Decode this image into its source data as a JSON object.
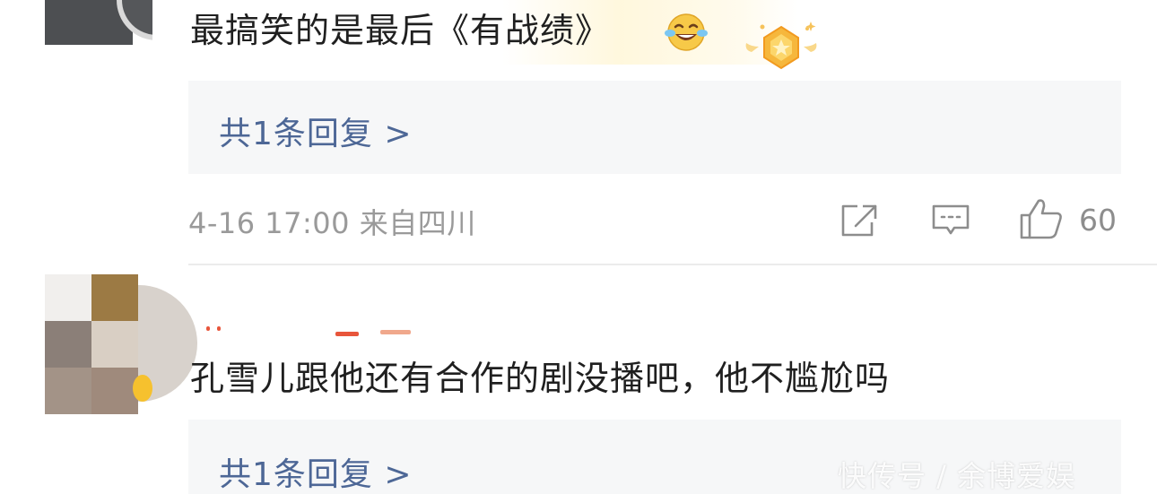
{
  "comments": [
    {
      "text": "最搞笑的是最后《有战绩》",
      "emoji": "laugh-cry-emoji",
      "badge": "star-badge-icon",
      "reply_link": "共1条回复 >",
      "meta": "4-16 17:00  来自四川",
      "actions": {
        "share_icon": "share-icon",
        "comment_icon": "comment-icon",
        "like_icon": "thumbs-up-icon",
        "like_count": "60"
      }
    },
    {
      "text": "孔雪儿跟他还有合作的剧没播吧，他不尴尬吗",
      "reply_link": "共1条回复 >"
    }
  ],
  "watermark": "快传号 / 余博爱娱",
  "colors": {
    "reply_link": "#4d6796",
    "reply_bg": "#f6f7f8",
    "meta_text": "#9a9a9a",
    "badge_gold": "#f6b73c"
  }
}
